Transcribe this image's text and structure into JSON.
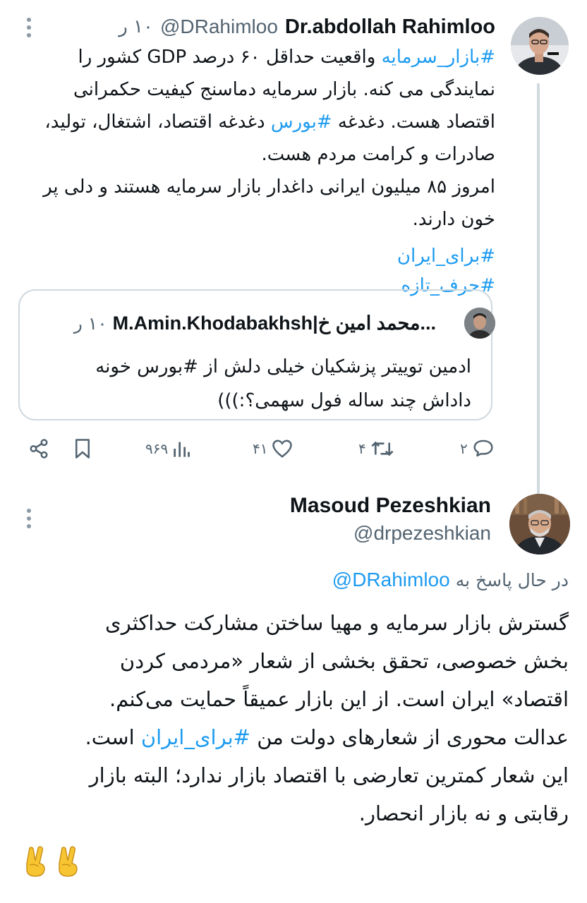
{
  "tweet1": {
    "name": "Dr.abdollah Rahimloo",
    "handle": "@DRahimloo",
    "time": "۱۰ ر",
    "body": {
      "l1_tag": "#بازار_سرمایه",
      "l1_text": " واقعیت حداقل ۶۰ درصد GDP کشور را",
      "l2": "نمایندگی می کنه. بازار سرمایه دماسنج کیفیت حکمرانی",
      "l3_a": "اقتصاد هست. دغدغه ",
      "l3_tag": "#بورس",
      "l3_b": " دغدغه اقتصاد، اشتغال، تولید،",
      "l4": "صادرات و کرامت مردم هست.",
      "l5": "امروز ۸۵ میلیون ایرانی داغدار بازار سرمایه هستند و دلی پر",
      "l6": "خون دارند.",
      "tag_a": "#برای_ایران",
      "tag_b": "#حرف_تازه"
    },
    "quote": {
      "name": "M.Amin.Khodabakhsh|محمد امین خ...",
      "time": "۱۰ ر",
      "l1": "ادمین توییتر پزشکیان خیلی دلش از #بورس خونه",
      "l2": "داداش چند ساله فول سهمی؟:)))"
    },
    "actions": {
      "replies": "۲",
      "retweets": "۴",
      "likes": "۴۱",
      "views": "۹۶۹"
    }
  },
  "tweet2": {
    "name": "Masoud Pezeshkian",
    "handle": "@drpezeshkian",
    "reply_prefix": "در حال پاسخ به",
    "reply_to": "@DRahimloo",
    "body": {
      "l1": "گسترش بازار سرمایه و مهیا ساختن مشارکت حداکثری",
      "l2": "بخش خصوصی، تحقق بخشی از شعار «مردمی کردن",
      "l3": "اقتصاد» ایران است. از این بازار عمیقاً حمایت می‌کنم.",
      "l4_a": "عدالت محوری از شعارهای دولت من ",
      "l4_tag": "#برای_ایران",
      "l4_b": " است.",
      "l5": "این شعار کمترین تعارضی با اقتصاد بازار ندارد؛ البته بازار",
      "l6": "رقابتی و نه بازار انحصار."
    },
    "emojis": [
      "✌",
      "✌"
    ]
  },
  "colors": {
    "link": "#1d9bf0",
    "muted": "#536471",
    "text": "#0f1419",
    "border": "#cfd9de"
  },
  "icons": [
    "more-icon",
    "reply-icon",
    "retweet-icon",
    "like-icon",
    "views-icon",
    "bookmark-icon",
    "share-icon",
    "victory-hand-icon"
  ]
}
